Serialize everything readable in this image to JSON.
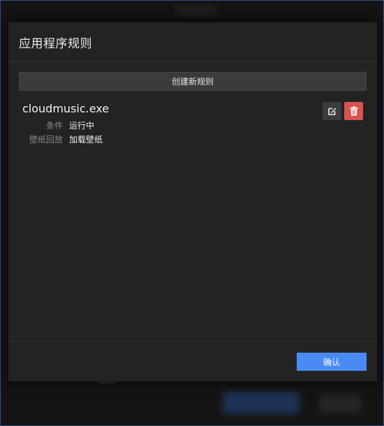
{
  "dialog": {
    "title": "应用程序规则",
    "create_button_label": "创建新规则",
    "confirm_button_label": "确认"
  },
  "rules": [
    {
      "name": "cloudmusic.exe",
      "condition_label": "条件",
      "condition_value": "运行中",
      "playback_label": "壁纸回放",
      "playback_value": "加载壁纸"
    }
  ],
  "icons": {
    "edit": "edit-icon",
    "delete": "trash-icon"
  },
  "colors": {
    "accent": "#4a8af4",
    "danger": "#d9534f",
    "dialog_bg": "#232323"
  }
}
